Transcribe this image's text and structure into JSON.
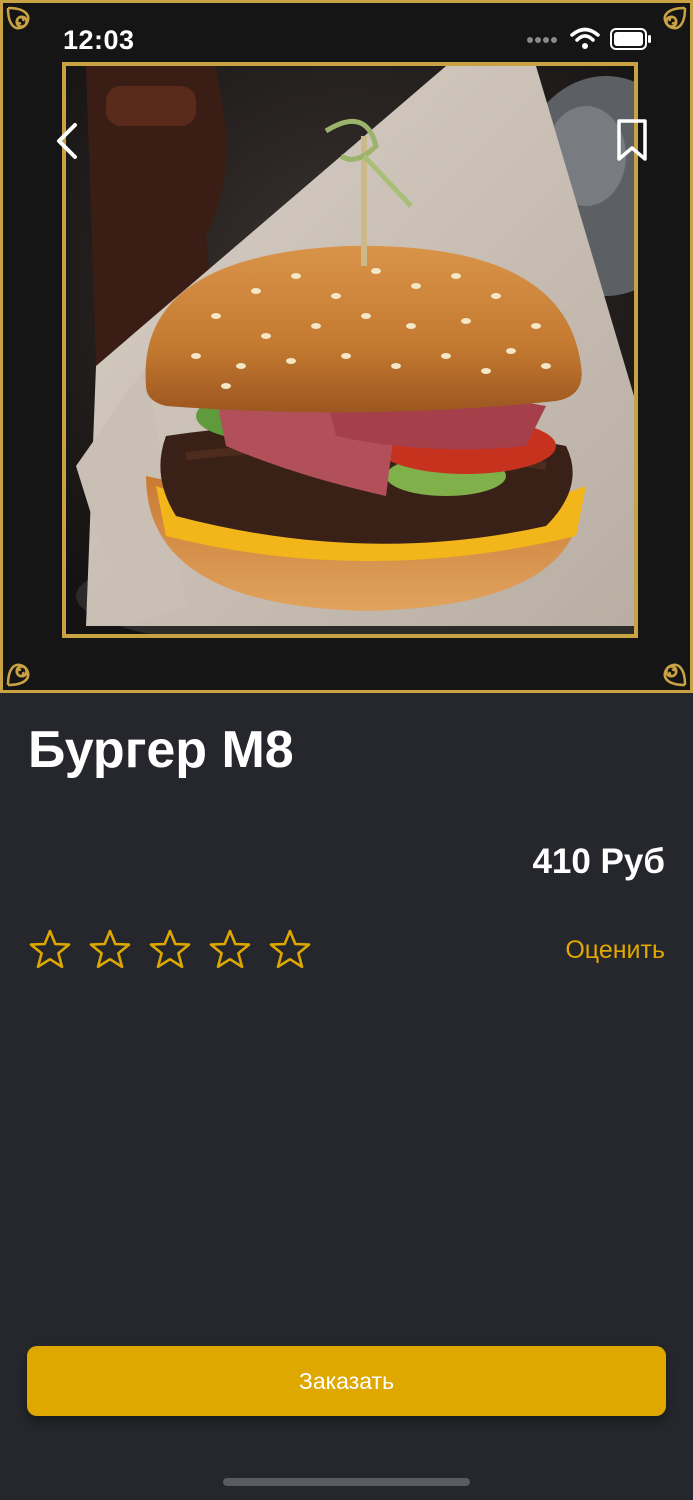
{
  "status_bar": {
    "time": "12:03"
  },
  "product": {
    "name": "Бургер М8",
    "price": "410 Руб",
    "rating": 0,
    "rating_max": 5,
    "rate_label": "Оценить"
  },
  "actions": {
    "order_label": "Заказать"
  },
  "icons": {
    "back": "chevron-left-icon",
    "bookmark": "bookmark-icon",
    "star": "star-outline-icon"
  },
  "colors": {
    "accent": "#dea800",
    "frame_gold": "#c9a243",
    "background": "#25272c"
  }
}
